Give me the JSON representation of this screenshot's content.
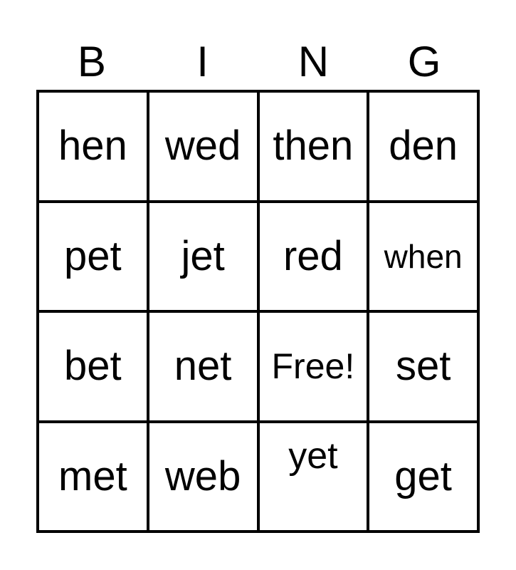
{
  "header": {
    "letters": [
      "B",
      "I",
      "N",
      "G"
    ]
  },
  "board": {
    "rows": [
      [
        "hen",
        "wed",
        "then",
        "den"
      ],
      [
        "pet",
        "jet",
        "red",
        "when"
      ],
      [
        "bet",
        "net",
        "Free!",
        "set"
      ],
      [
        "met",
        "web",
        "yet",
        "get"
      ]
    ],
    "free_space": "Free!"
  },
  "colors": {
    "text": "#000000",
    "border": "#000000",
    "background": "#ffffff"
  }
}
